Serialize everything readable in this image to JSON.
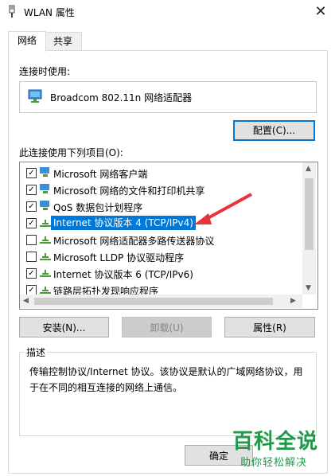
{
  "window": {
    "title": "WLAN 属性",
    "close_glyph": "✕"
  },
  "tabs": [
    {
      "label": "网络"
    },
    {
      "label": "共享"
    }
  ],
  "connect_using": {
    "label": "连接时使用:",
    "adapter": "Broadcom 802.11n 网络适配器"
  },
  "buttons": {
    "configure": "配置(C)...",
    "install": "安装(N)...",
    "uninstall": "卸载(U)",
    "properties": "属性(R)",
    "ok": "确定"
  },
  "items_label": "此连接使用下列项目(O):",
  "items": [
    {
      "label": "Microsoft 网络客户端",
      "checked": true
    },
    {
      "label": "Microsoft 网络的文件和打印机共享",
      "checked": true
    },
    {
      "label": "QoS 数据包计划程序",
      "checked": true
    },
    {
      "label": "Internet 协议版本 4 (TCP/IPv4)",
      "checked": true,
      "selected": true
    },
    {
      "label": "Microsoft 网络适配器多路传送器协议",
      "checked": false
    },
    {
      "label": "Microsoft LLDP 协议驱动程序",
      "checked": false
    },
    {
      "label": "Internet 协议版本 6 (TCP/IPv6)",
      "checked": true
    },
    {
      "label": "链路层拓扑发现响应程序",
      "checked": true
    }
  ],
  "description": {
    "title": "描述",
    "text": "传输控制协议/Internet 协议。该协议是默认的广域网络协议，用于在不同的相互连接的网络上通信。"
  },
  "watermark": {
    "main": "百科全说",
    "sub": "助你轻松解决"
  },
  "colors": {
    "selection": "#0078d7",
    "annotation_arrow": "#e8323c",
    "watermark": "#1e9a4a"
  }
}
